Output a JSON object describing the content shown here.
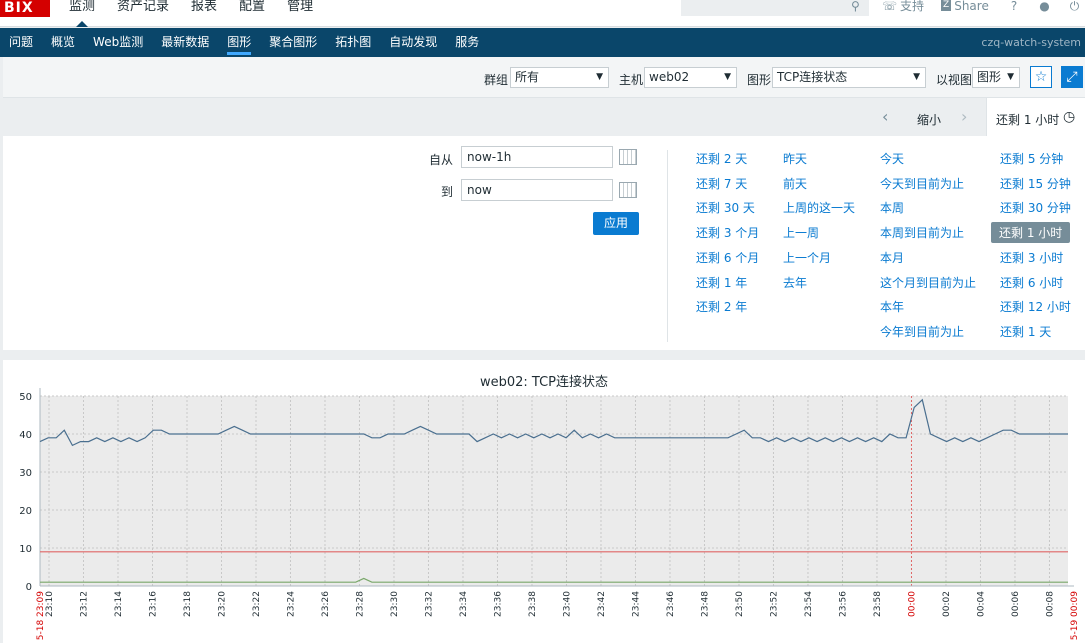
{
  "topbar": {
    "logo": "BIX",
    "menu": [
      "监测",
      "资产记录",
      "报表",
      "配置",
      "管理"
    ],
    "links": {
      "support": "支持",
      "share": "Share",
      "help": "?",
      "user": "user",
      "logout": "logout"
    }
  },
  "navbar": {
    "items": [
      "问题",
      "概览",
      "Web监测",
      "最新数据",
      "图形",
      "聚合图形",
      "拓扑图",
      "自动发现",
      "服务"
    ],
    "server": "czq-watch-system"
  },
  "filter": {
    "group_label": "群组",
    "group_value": "所有",
    "host_label": "主机",
    "host_value": "web02",
    "graph_label": "图形",
    "graph_value": "TCP连接状态",
    "view_label": "以视图",
    "view_value": "图形"
  },
  "timebar": {
    "zoom_out": "缩小",
    "tab": "还剩 1 小时"
  },
  "timepanel": {
    "from_label": "自从",
    "from_value": "now-1h",
    "to_label": "到",
    "to_value": "now",
    "apply": "应用",
    "col1": [
      "还剩 2 天",
      "还剩 7 天",
      "还剩 30 天",
      "还剩 3 个月",
      "还剩 6 个月",
      "还剩 1 年",
      "还剩 2 年"
    ],
    "col2": [
      "昨天",
      "前天",
      "上周的这一天",
      "上一周",
      "上一个月",
      "去年"
    ],
    "col3": [
      "今天",
      "今天到目前为止",
      "本周",
      "本周到目前为止",
      "本月",
      "这个月到目前为止",
      "本年",
      "今年到目前为止"
    ],
    "col4": [
      "还剩 5 分钟",
      "还剩 15 分钟",
      "还剩 30 分钟",
      "还剩 1 小时",
      "还剩 3 小时",
      "还剩 6 小时",
      "还剩 12 小时",
      "还剩 1 天"
    ],
    "active": "还剩 1 小时"
  },
  "chart_data": {
    "type": "line",
    "title": "web02: TCP连接状态",
    "ylim": [
      0,
      50
    ],
    "yticks": [
      0,
      10,
      20,
      30,
      40,
      50
    ],
    "xticks": [
      "23:10",
      "23:12",
      "23:14",
      "23:16",
      "23:18",
      "23:20",
      "23:22",
      "23:24",
      "23:26",
      "23:28",
      "23:30",
      "23:32",
      "23:34",
      "23:36",
      "23:38",
      "23:40",
      "23:42",
      "23:44",
      "23:46",
      "23:48",
      "23:50",
      "23:52",
      "23:54",
      "23:56",
      "23:58",
      "00:00",
      "00:02",
      "00:04",
      "00:06",
      "00:08"
    ],
    "red_xticks": [
      "00:00"
    ],
    "start_label": "5-18 23:09",
    "end_label": "5-19 00:09",
    "series": [
      {
        "color": "#4a6f8f",
        "values": [
          38,
          39,
          39,
          41,
          37,
          38,
          38,
          39,
          38,
          39,
          38,
          39,
          38,
          39,
          41,
          41,
          40,
          40,
          40,
          40,
          40,
          40,
          40,
          41,
          42,
          41,
          40,
          40,
          40,
          40,
          40,
          40,
          40,
          40,
          40,
          40,
          40,
          40,
          40,
          40,
          40,
          39,
          39,
          40,
          40,
          40,
          41,
          42,
          41,
          40,
          40,
          40,
          40,
          40,
          38,
          39,
          40,
          39,
          40,
          39,
          40,
          39,
          40,
          39,
          40,
          39,
          41,
          39,
          40,
          39,
          40,
          39,
          39,
          39,
          39,
          39,
          39,
          39,
          39,
          39,
          39,
          39,
          39,
          39,
          39,
          39,
          40,
          41,
          39,
          39,
          38,
          39,
          38,
          39,
          38,
          39,
          38,
          39,
          38,
          39,
          38,
          39,
          38,
          39,
          38,
          40,
          39,
          39,
          47,
          49,
          40,
          39,
          38,
          39,
          38,
          39,
          38,
          39,
          40,
          41,
          41,
          40,
          40,
          40,
          40,
          40,
          40,
          40
        ]
      },
      {
        "color": "#e06666",
        "values": [
          9,
          9
        ]
      },
      {
        "color": "#7aa86b",
        "values": [
          1,
          1,
          1,
          1,
          1,
          1,
          1,
          1,
          1,
          1,
          1,
          1,
          1,
          1,
          1,
          1,
          1,
          1,
          1,
          1,
          1,
          1,
          1,
          1,
          1,
          1,
          1,
          1,
          1,
          1,
          1,
          1,
          1,
          1,
          1,
          1,
          1,
          1,
          1,
          1,
          2,
          1,
          1,
          1,
          1,
          1,
          1,
          1,
          1,
          1,
          1,
          1,
          1,
          1,
          1,
          1,
          1,
          1,
          1,
          1,
          1,
          1,
          1,
          1,
          1,
          1,
          1,
          1,
          1,
          1,
          1,
          1,
          1,
          1,
          1,
          1,
          1,
          1,
          1,
          1,
          1,
          1,
          1,
          1,
          1,
          1,
          1,
          1,
          1,
          1,
          1,
          1,
          1,
          1,
          1,
          1,
          1,
          1,
          1,
          1,
          1,
          1,
          1,
          1,
          1,
          1,
          1,
          1,
          1,
          1,
          1,
          1,
          1,
          1,
          1,
          1,
          1,
          1,
          1,
          1,
          1,
          1,
          1,
          1,
          1,
          1,
          1,
          1
        ]
      }
    ]
  }
}
